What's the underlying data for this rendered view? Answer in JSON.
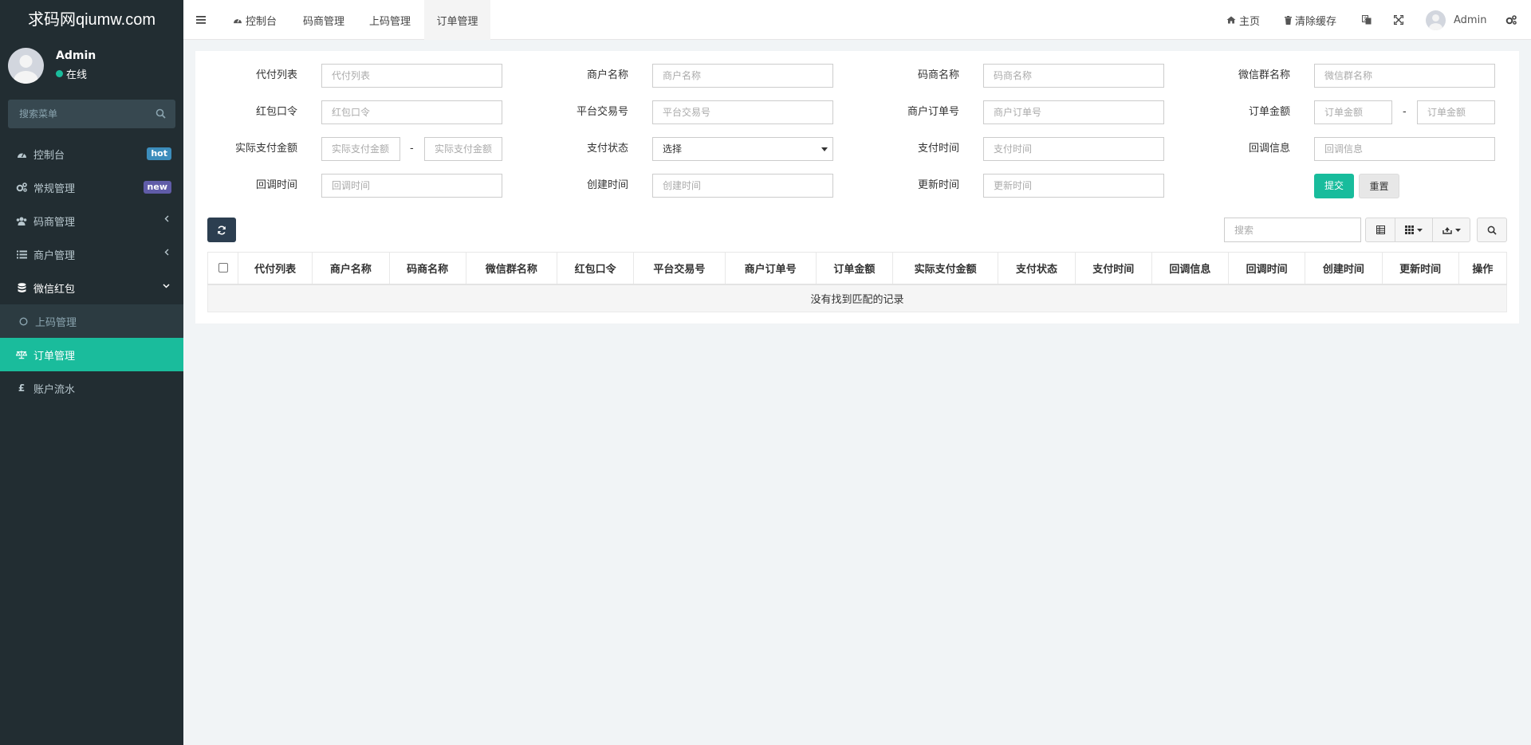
{
  "app": {
    "logo": "求码网qiumw.com"
  },
  "user": {
    "name": "Admin",
    "status": "在线"
  },
  "sidebar": {
    "search_placeholder": "搜索菜单",
    "items": [
      {
        "label": "控制台",
        "icon": "dashboard-icon",
        "badge": "hot",
        "badge_color": "#3c8dbc"
      },
      {
        "label": "常规管理",
        "icon": "cogs-icon",
        "badge": "new",
        "badge_color": "#605ca8"
      },
      {
        "label": "码商管理",
        "icon": "users-icon"
      },
      {
        "label": "商户管理",
        "icon": "list-icon"
      },
      {
        "label": "微信红包",
        "icon": "database-icon"
      },
      {
        "label": "上码管理",
        "icon": "circle-o-icon"
      },
      {
        "label": "订单管理",
        "icon": "balance-scale-icon"
      },
      {
        "label": "账户流水",
        "icon": "gbp-icon"
      }
    ]
  },
  "topbar": {
    "tabs": [
      {
        "label": "控制台",
        "icon": "dashboard-icon"
      },
      {
        "label": "码商管理"
      },
      {
        "label": "上码管理"
      },
      {
        "label": "订单管理"
      }
    ],
    "home": "主页",
    "clear_cache": "清除缓存",
    "admin": "Admin"
  },
  "filters": {
    "row1": [
      {
        "label": "代付列表",
        "placeholder": "代付列表"
      },
      {
        "label": "商户名称",
        "placeholder": "商户名称"
      },
      {
        "label": "码商名称",
        "placeholder": "码商名称"
      },
      {
        "label": "微信群名称",
        "placeholder": "微信群名称"
      }
    ],
    "row2": [
      {
        "label": "红包口令",
        "placeholder": "红包口令"
      },
      {
        "label": "平台交易号",
        "placeholder": "平台交易号"
      },
      {
        "label": "商户订单号",
        "placeholder": "商户订单号"
      },
      {
        "label": "订单金额",
        "placeholder_min": "订单金额",
        "placeholder_max": "订单金额"
      }
    ],
    "row3": [
      {
        "label": "实际支付金额",
        "placeholder_min": "实际支付金额",
        "placeholder_max": "实际支付金额"
      },
      {
        "label": "支付状态",
        "value": "选择"
      },
      {
        "label": "支付时间",
        "placeholder": "支付时间"
      },
      {
        "label": "回调信息",
        "placeholder": "回调信息"
      }
    ],
    "row4": [
      {
        "label": "回调时间",
        "placeholder": "回调时间"
      },
      {
        "label": "创建时间",
        "placeholder": "创建时间"
      },
      {
        "label": "更新时间",
        "placeholder": "更新时间"
      }
    ],
    "dash": "-",
    "submit": "提交",
    "reset": "重置"
  },
  "table": {
    "search_placeholder": "搜索",
    "columns": [
      "代付列表",
      "商户名称",
      "码商名称",
      "微信群名称",
      "红包口令",
      "平台交易号",
      "商户订单号",
      "订单金额",
      "实际支付金额",
      "支付状态",
      "支付时间",
      "回调信息",
      "回调时间",
      "创建时间",
      "更新时间",
      "操作"
    ],
    "empty_text": "没有找到匹配的记录"
  }
}
